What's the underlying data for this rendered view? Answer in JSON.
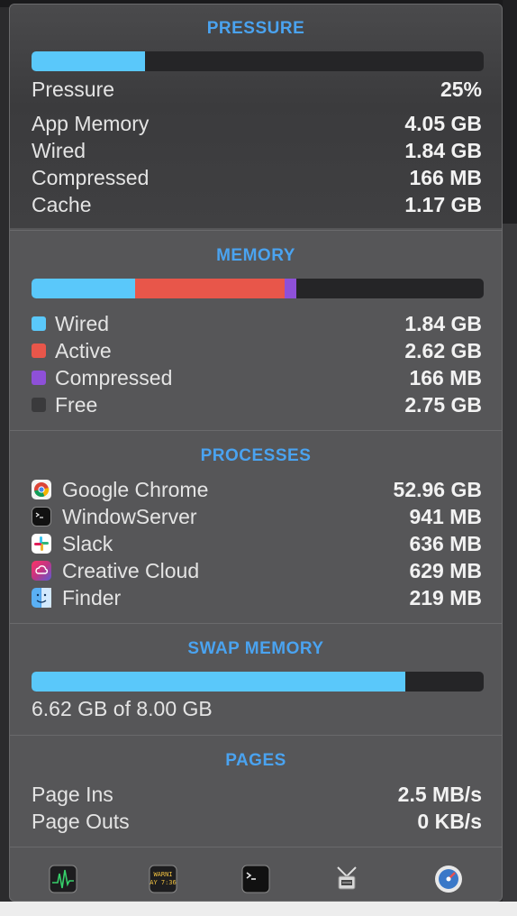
{
  "colors": {
    "accent": "#4aa3f0",
    "wired": "#5ac8fa",
    "active": "#e8564a",
    "compressed": "#8e50d8",
    "free": "#3a3a3c",
    "bar_track": "#252527"
  },
  "pressure": {
    "title": "PRESSURE",
    "level_fraction": 0.25,
    "label": "Pressure",
    "value": "25%",
    "stats": [
      {
        "label": "App Memory",
        "value": "4.05 GB"
      },
      {
        "label": "Wired",
        "value": "1.84 GB"
      },
      {
        "label": "Compressed",
        "value": "166 MB"
      },
      {
        "label": "Cache",
        "value": "1.17 GB"
      }
    ]
  },
  "memory": {
    "title": "MEMORY",
    "breakdown_fractions": {
      "wired": 0.23,
      "active": 0.33,
      "compressed": 0.025
    },
    "items": [
      {
        "label": "Wired",
        "value": "1.84 GB",
        "color": "#5ac8fa"
      },
      {
        "label": "Active",
        "value": "2.62 GB",
        "color": "#e8564a"
      },
      {
        "label": "Compressed",
        "value": "166 MB",
        "color": "#8e50d8"
      },
      {
        "label": "Free",
        "value": "2.75 GB",
        "color": "#3a3a3c"
      }
    ]
  },
  "processes": {
    "title": "PROCESSES",
    "items": [
      {
        "name": "Google Chrome",
        "value": "52.96 GB",
        "icon": "chrome-icon"
      },
      {
        "name": "WindowServer",
        "value": "941 MB",
        "icon": "terminal-icon"
      },
      {
        "name": "Slack",
        "value": "636 MB",
        "icon": "slack-icon"
      },
      {
        "name": "Creative Cloud",
        "value": "629 MB",
        "icon": "creative-cloud-icon"
      },
      {
        "name": "Finder",
        "value": "219 MB",
        "icon": "finder-icon"
      }
    ]
  },
  "swap": {
    "title": "SWAP MEMORY",
    "used_fraction": 0.8275,
    "summary": "6.62 GB of 8.00 GB"
  },
  "pages": {
    "title": "PAGES",
    "items": [
      {
        "label": "Page Ins",
        "value": "2.5 MB/s"
      },
      {
        "label": "Page Outs",
        "value": "0 KB/s"
      }
    ]
  },
  "toolbar": {
    "buttons": [
      {
        "name": "activity-monitor",
        "icon": "activity-monitor-icon"
      },
      {
        "name": "console",
        "icon": "console-icon",
        "text": "WARNI AY 7:36"
      },
      {
        "name": "terminal",
        "icon": "terminal-icon"
      },
      {
        "name": "system-information",
        "icon": "system-information-icon"
      },
      {
        "name": "disk-utility",
        "icon": "speed-gauge-icon"
      }
    ]
  }
}
